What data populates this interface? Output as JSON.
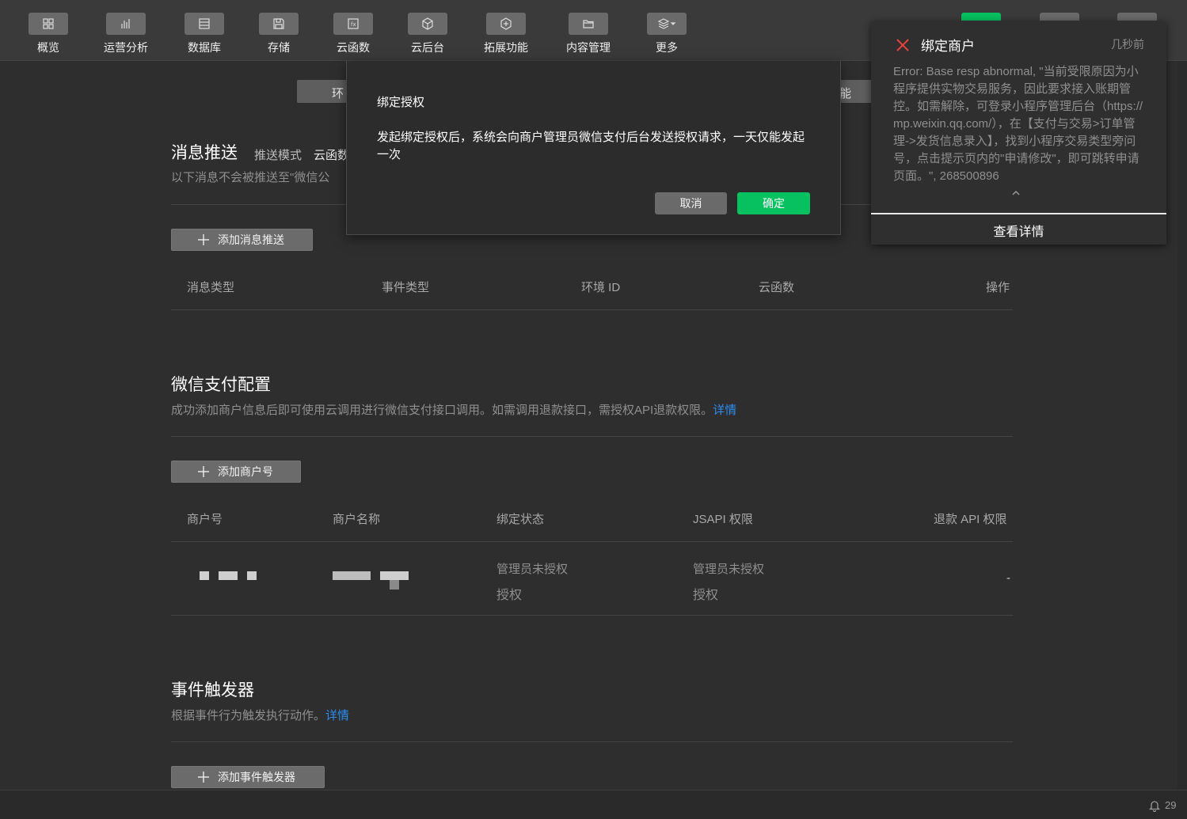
{
  "toolbar": {
    "items": [
      {
        "label": "概览",
        "icon": "grid-icon"
      },
      {
        "label": "运营分析",
        "icon": "bar-chart-icon"
      },
      {
        "label": "数据库",
        "icon": "database-icon"
      },
      {
        "label": "存储",
        "icon": "save-icon"
      },
      {
        "label": "云函数",
        "icon": "function-icon"
      },
      {
        "label": "云后台",
        "icon": "cube-icon"
      },
      {
        "label": "拓展功能",
        "icon": "extension-icon"
      },
      {
        "label": "内容管理",
        "icon": "folder-icon"
      },
      {
        "label": "更多",
        "icon": "layers-icon"
      }
    ]
  },
  "tabs": {
    "left_partial": "环",
    "right_partial": "能"
  },
  "message_push": {
    "title": "消息推送",
    "mode_label": "推送模式",
    "mode_value": "云函数",
    "desc": "以下消息不会被推送至\"微信公",
    "add_button": "添加消息推送",
    "columns": [
      "消息类型",
      "事件类型",
      "环境 ID",
      "云函数",
      "操作"
    ]
  },
  "wxpay": {
    "title": "微信支付配置",
    "desc": "成功添加商户信息后即可使用云调用进行微信支付接口调用。如需调用退款接口，需授权API退款权限。",
    "desc_link": "详情",
    "add_button": "添加商户号",
    "columns": [
      "商户号",
      "商户名称",
      "绑定状态",
      "JSAPI 权限",
      "退款 API 权限"
    ],
    "row": {
      "bind_status": "管理员未授权",
      "bind_action": "授权",
      "jsapi_status": "管理员未授权",
      "jsapi_action": "授权",
      "refund": "-"
    }
  },
  "event_trigger": {
    "title": "事件触发器",
    "desc": "根据事件行为触发执行动作。",
    "desc_link": "详情",
    "add_button": "添加事件触发器"
  },
  "modal": {
    "title": "绑定授权",
    "body": "发起绑定授权后，系统会向商户管理员微信支付后台发送授权请求，一天仅能发起一次",
    "cancel": "取消",
    "confirm": "确定"
  },
  "notification": {
    "title": "绑定商户",
    "time": "几秒前",
    "body": "Error: Base resp abnormal, \"当前受限原因为小程序提供实物交易服务，因此要求接入账期管控。如需解除，可登录小程序管理后台（https://mp.weixin.qq.com/），在【支付与交易>订单管理->发货信息录入】，找到小程序交易类型旁问号，点击提示页内的\"申请修改\"，即可跳转申请页面。\", 268500896",
    "detail_button": "查看详情"
  },
  "statusbar": {
    "notification_count": "29"
  },
  "colors": {
    "accent_green": "#07c160",
    "link_blue": "#2d8cf0",
    "error_red": "#e64340"
  }
}
